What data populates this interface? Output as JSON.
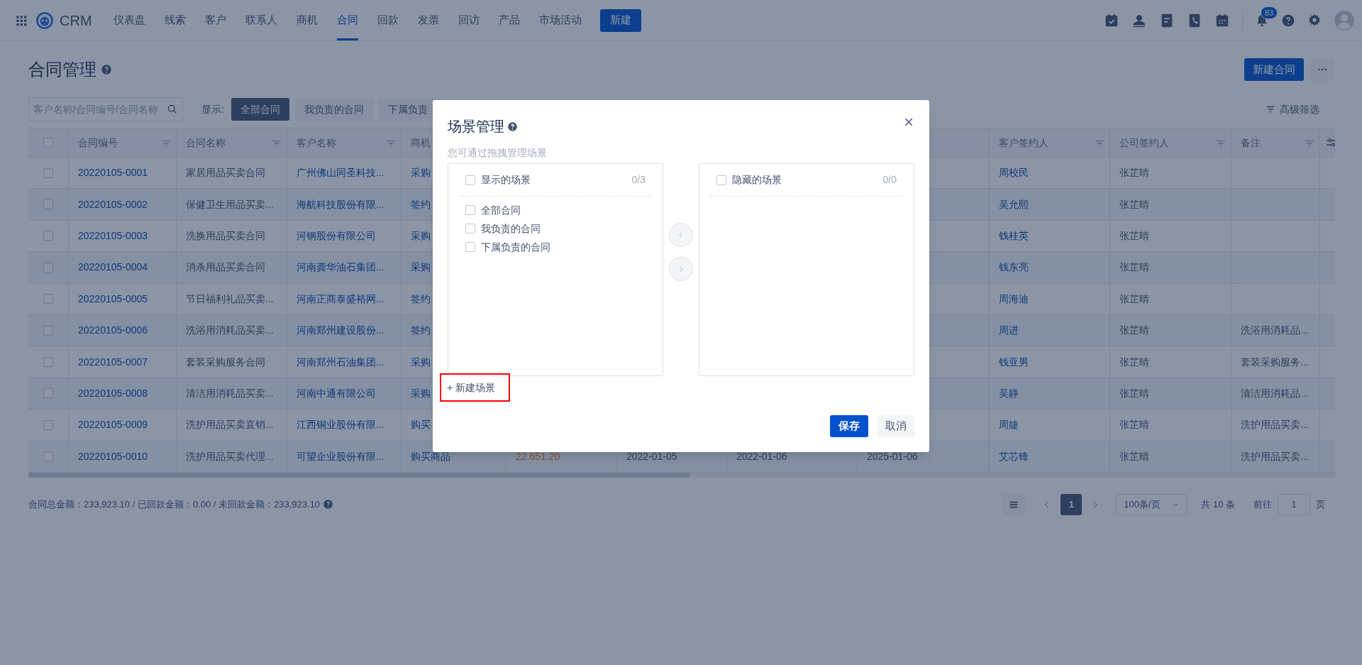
{
  "nav": {
    "app_name": "CRM",
    "items": [
      {
        "label": "仪表盘",
        "selected": false
      },
      {
        "label": "线索",
        "selected": false
      },
      {
        "label": "客户",
        "selected": false
      },
      {
        "label": "联系人",
        "selected": false
      },
      {
        "label": "商机",
        "selected": false
      },
      {
        "label": "合同",
        "selected": true
      },
      {
        "label": "回款",
        "selected": false
      },
      {
        "label": "发票",
        "selected": false
      },
      {
        "label": "回访",
        "selected": false
      },
      {
        "label": "产品",
        "selected": false
      },
      {
        "label": "市场活动",
        "selected": false
      }
    ],
    "new_button": "新建",
    "notification_count": "83"
  },
  "page": {
    "title": "合同管理",
    "primary_button": "新建合同"
  },
  "toolbar": {
    "search": {
      "placeholder": "客户名称/合同编号/合同名称"
    },
    "filter_label": "显示:",
    "scenes": [
      {
        "label": "全部合同",
        "selected": true
      },
      {
        "label": "我负责的合同",
        "selected": false
      },
      {
        "label": "下属负责",
        "selected": false
      }
    ],
    "advanced_filter": "高级筛选"
  },
  "table": {
    "all_checked": false,
    "columns": [
      {
        "label": "合同编号"
      },
      {
        "label": "合同名称"
      },
      {
        "label": "客户名称"
      },
      {
        "label": "商机"
      },
      null,
      null,
      null,
      null,
      {
        "label": "客户签约人"
      },
      {
        "label": "公司签约人"
      },
      {
        "label": "备注"
      },
      {
        "kind": "settings"
      }
    ],
    "rows": [
      {
        "checked": false,
        "cells": [
          "20220105-0001",
          "家居用品买卖合同",
          "广州佛山同圣科技...",
          "采购",
          null,
          null,
          null,
          null,
          "周校民",
          "张芷晴",
          null,
          null
        ]
      },
      {
        "checked": false,
        "cells": [
          "20220105-0002",
          "保健卫生用品买卖...",
          "海航科技股份有限...",
          "签约",
          null,
          null,
          null,
          null,
          "吴允熙",
          "张芷晴",
          null,
          null
        ]
      },
      {
        "checked": false,
        "cells": [
          "20220105-0003",
          "洗换用品买卖合同",
          "河钢股份有限公司",
          "采购",
          null,
          null,
          null,
          null,
          "钱桂英",
          "张芷晴",
          null,
          null
        ]
      },
      {
        "checked": false,
        "cells": [
          "20220105-0004",
          "消杀用品买卖合同",
          "河南龚华油石集团...",
          "采购",
          null,
          null,
          null,
          null,
          "钱东亮",
          "张芷晴",
          null,
          null
        ]
      },
      {
        "checked": false,
        "cells": [
          "20220105-0005",
          "节日福利礼品买卖...",
          "河南正商泰盛裕网...",
          "签约",
          null,
          null,
          null,
          null,
          "周海迪",
          "张芷晴",
          null,
          null
        ]
      },
      {
        "checked": false,
        "cells": [
          "20220105-0006",
          "洗浴用消耗品买卖...",
          "河南郑州建设股份...",
          "签约",
          null,
          null,
          null,
          null,
          "周进",
          "张芷晴",
          "洗浴用消耗品...",
          null
        ]
      },
      {
        "checked": false,
        "cells": [
          "20220105-0007",
          "套装采购服务合同",
          "河南郑州石油集团...",
          "采购",
          null,
          null,
          null,
          null,
          "钱亚男",
          "张芷晴",
          "套装采购服务...",
          null
        ]
      },
      {
        "checked": false,
        "cells": [
          "20220105-0008",
          "清洁用消耗品买卖...",
          "河南中通有限公司",
          "采购",
          null,
          null,
          null,
          null,
          "吴静",
          "张芷晴",
          "清洁用消耗品...",
          null
        ]
      },
      {
        "checked": false,
        "cells": [
          "20220105-0009",
          "洗护用品买卖直销...",
          "江西铜业股份有限...",
          "购买",
          null,
          null,
          null,
          null,
          "周婕",
          "张芷晴",
          "洗护用品买卖...",
          null
        ]
      },
      {
        "checked": false,
        "cells": [
          "20220105-0010",
          "洗护用品买卖代理...",
          "可望企业股份有限...",
          "购买商品",
          "22.651.20",
          "2022-01-05",
          "2022-01-06",
          "2025-01-06",
          "艾芯锋",
          "张芷晴",
          "洗护用品买卖...",
          null
        ]
      }
    ]
  },
  "summary": "合同总金额：233,923.10 / 已回款金额：0.00 / 未回款金额：233,923.10",
  "pagination": {
    "pages": [
      {
        "label": "1",
        "selected": true
      }
    ],
    "page_size": "100条/页",
    "total": "共 10 条",
    "goto_label": "前往",
    "goto_value": "1",
    "goto_suffix": "页"
  },
  "dialog": {
    "title": "场景管理",
    "hint": "您可通过拖拽管理场景",
    "shown": {
      "title": "显示的场景",
      "count": "0/3",
      "checked": false,
      "items": [
        {
          "label": "全部合同",
          "checked": false
        },
        {
          "label": "我负责的合同",
          "checked": false
        },
        {
          "label": "下属负责的合同",
          "checked": false
        }
      ]
    },
    "hidden": {
      "title": "隐藏的场景",
      "count": "0/0",
      "checked": false
    },
    "new_scene": "+ 新建场景",
    "new_scene_highlighted": true,
    "save": "保存",
    "cancel": "取消"
  }
}
